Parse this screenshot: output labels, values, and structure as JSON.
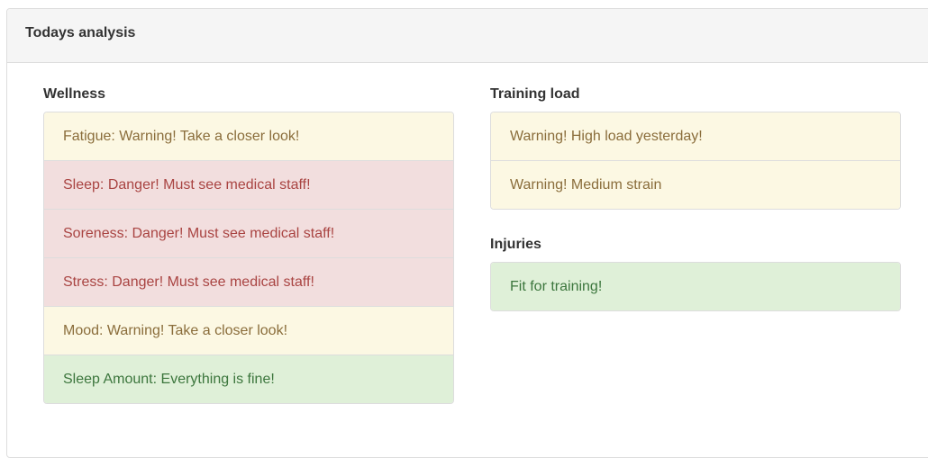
{
  "panel": {
    "title": "Todays analysis"
  },
  "wellness": {
    "title": "Wellness",
    "items": [
      {
        "text": "Fatigue: Warning! Take a closer look!",
        "status": "warning"
      },
      {
        "text": "Sleep: Danger! Must see medical staff!",
        "status": "danger"
      },
      {
        "text": "Soreness: Danger! Must see medical staff!",
        "status": "danger"
      },
      {
        "text": "Stress: Danger! Must see medical staff!",
        "status": "danger"
      },
      {
        "text": "Mood: Warning! Take a closer look!",
        "status": "warning"
      },
      {
        "text": "Sleep Amount: Everything is fine!",
        "status": "success"
      }
    ]
  },
  "training_load": {
    "title": "Training load",
    "items": [
      {
        "text": "Warning! High load yesterday!",
        "status": "warning"
      },
      {
        "text": "Warning! Medium strain",
        "status": "warning"
      }
    ]
  },
  "injuries": {
    "title": "Injuries",
    "items": [
      {
        "text": "Fit for training!",
        "status": "success"
      }
    ]
  },
  "colors": {
    "warning_bg": "#fcf8e3",
    "warning_text": "#8a6d3b",
    "danger_bg": "#f2dede",
    "danger_text": "#a94442",
    "success_bg": "#dff0d8",
    "success_text": "#3c763d"
  }
}
